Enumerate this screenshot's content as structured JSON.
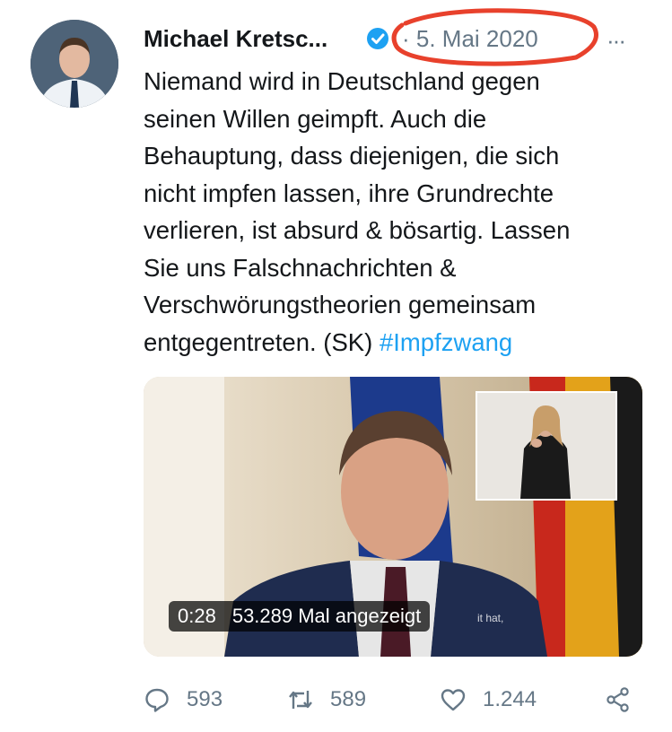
{
  "tweet": {
    "author_name": "Michael Kretsc...",
    "date": "· 5. Mai 2020",
    "more": "···",
    "text_lines": [
      "Niemand wird in Deutschland gegen",
      "seinen Willen geimpft. Auch die",
      "Behauptung, dass diejenigen, die sich",
      "nicht impfen lassen, ihre Grundrechte",
      "verlieren, ist absurd & bösartig. Lassen",
      "Sie uns Falschnachrichten &",
      "Verschwörungstheorien  gemeinsam"
    ],
    "text_last_line": "entgegentreten. (SK) ",
    "hashtag": "#Impfzwang"
  },
  "media": {
    "duration": "0:28",
    "views": "53.289 Mal angezeigt",
    "subtitle_fragment": "it hat,"
  },
  "actions": {
    "reply_count": "593",
    "retweet_count": "589",
    "like_count": "1.244"
  },
  "colors": {
    "hashtag": "#1da1f2",
    "muted": "#657786",
    "verified": "#1da1f2",
    "highlight_circle": "#e8412c"
  },
  "icons": {
    "verified": "verified-badge-icon",
    "reply": "speech-bubble-icon",
    "retweet": "retweet-arrows-icon",
    "like": "heart-icon",
    "share": "share-nodes-icon"
  }
}
